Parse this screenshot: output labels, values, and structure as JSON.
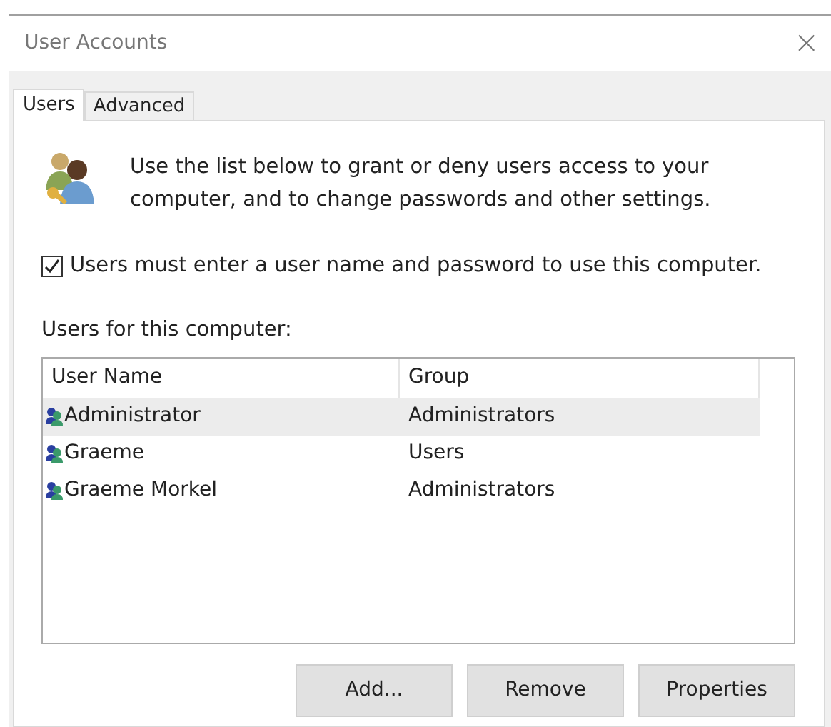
{
  "window": {
    "title": "User Accounts",
    "close": "×"
  },
  "tabs": [
    {
      "label": "Users",
      "selected": true
    },
    {
      "label": "Advanced",
      "selected": false
    }
  ],
  "intro": "Use the list below to grant or deny users access to your computer, and to change passwords and other settings.",
  "require_password": {
    "label": "Users must enter a user name and password to use this computer.",
    "checked": true
  },
  "list_label": "Users for this computer:",
  "table": {
    "columns": [
      "User Name",
      "Group"
    ],
    "rows": [
      {
        "name": "Administrator",
        "group": "Administrators",
        "selected": true
      },
      {
        "name": "Graeme",
        "group": "Users",
        "selected": false
      },
      {
        "name": "Graeme Morkel",
        "group": "Administrators",
        "selected": false
      }
    ]
  },
  "buttons": [
    "Add...",
    "Remove",
    "Properties"
  ]
}
